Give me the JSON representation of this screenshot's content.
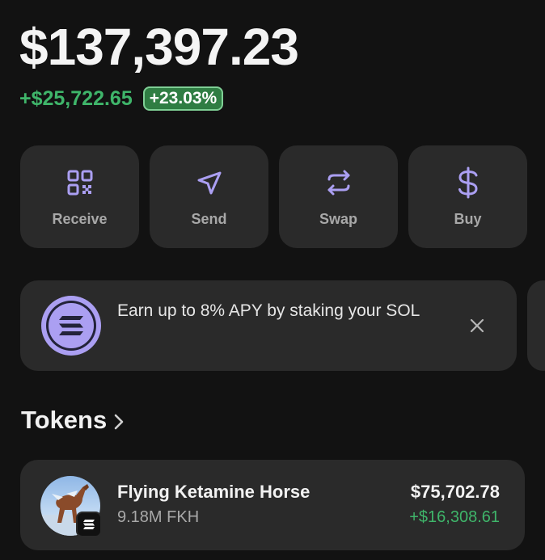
{
  "balance": {
    "total": "$137,397.23",
    "change_amount": "+$25,722.65",
    "change_percent": "+23.03%"
  },
  "colors": {
    "accent": "#ab9ff2",
    "positive": "#3fb56a",
    "card": "#2a2a2a",
    "background": "#121212"
  },
  "actions": [
    {
      "label": "Receive",
      "icon": "qr-code-icon"
    },
    {
      "label": "Send",
      "icon": "send-icon"
    },
    {
      "label": "Swap",
      "icon": "swap-icon"
    },
    {
      "label": "Buy",
      "icon": "dollar-icon"
    }
  ],
  "banner": {
    "text": "Earn up to 8% APY by staking your SOL",
    "icon": "solana-icon",
    "close_icon": "close-icon"
  },
  "tokens": {
    "title": "Tokens",
    "items": [
      {
        "name": "Flying Ketamine Horse",
        "amount": "9.18M FKH",
        "value": "$75,702.78",
        "change": "+$16,308.61"
      }
    ]
  }
}
